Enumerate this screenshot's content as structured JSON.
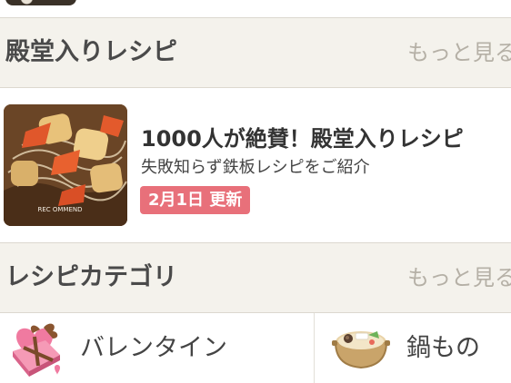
{
  "sections": {
    "hall_of_fame": {
      "title": "殿堂入りレシピ",
      "more": "もっと見る"
    },
    "categories": {
      "title": "レシピカテゴリ",
      "more": "もっと見る"
    }
  },
  "feature": {
    "title": "1000人が絶賛！殿堂入りレシピ",
    "description": "失敗知らず鉄板レシピをご紹介",
    "badge": "2月1日 更新",
    "thumb_caption": "REC OMMEND"
  },
  "category_items": [
    {
      "label": "バレンタイン",
      "icon": "heart-gift-box-icon"
    },
    {
      "label": "鍋もの",
      "icon": "hot-pot-icon"
    }
  ],
  "colors": {
    "section_bg": "#f4f2ec",
    "badge_bg": "#e8707a",
    "divider": "#dcd8cf"
  }
}
